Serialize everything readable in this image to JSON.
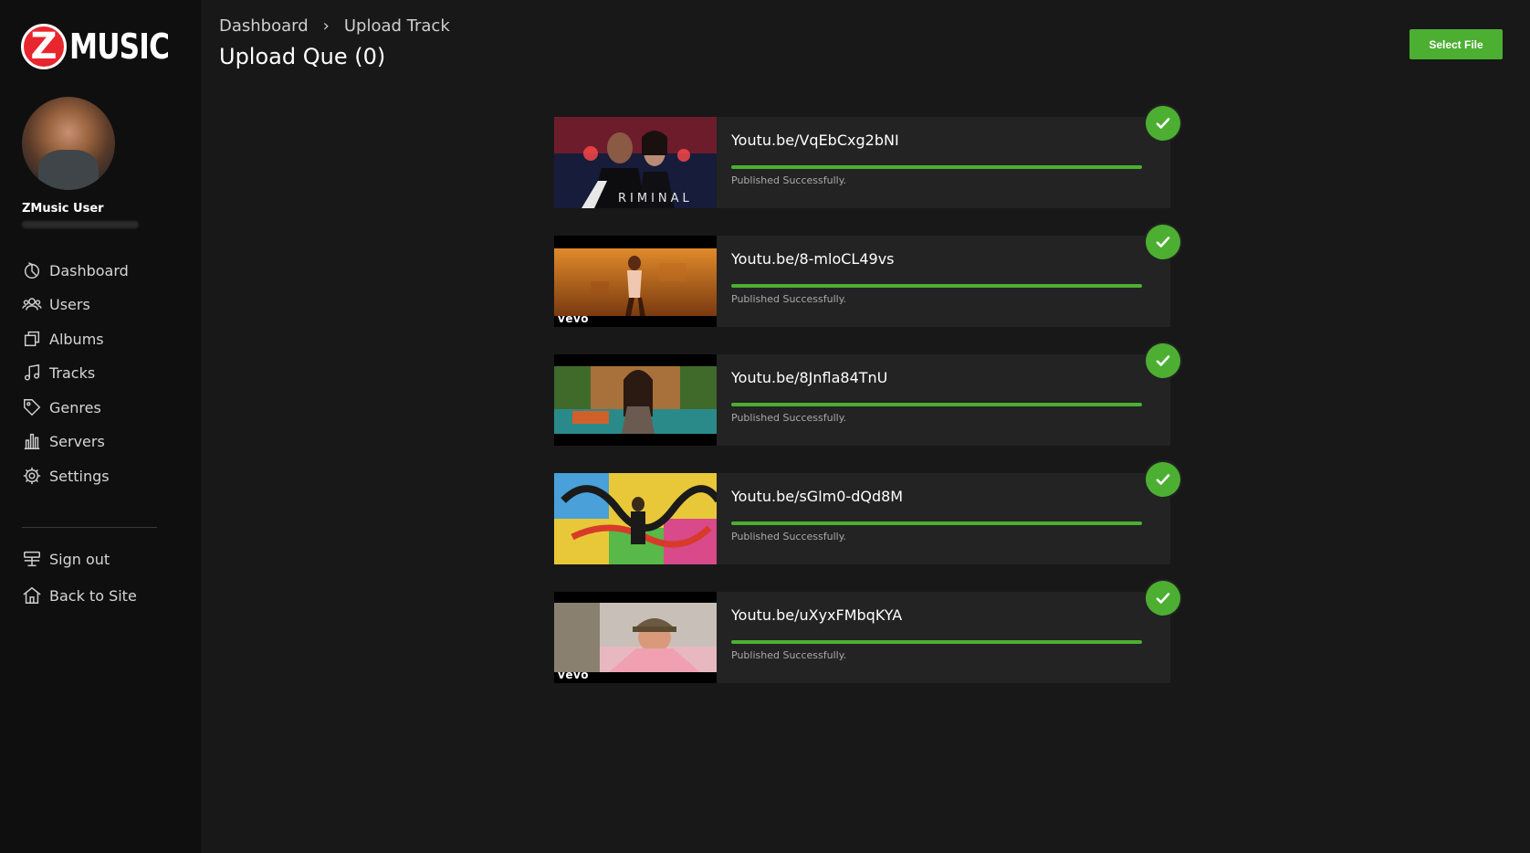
{
  "brand": {
    "logo_letter": "Z",
    "logo_text": "MUSIC",
    "accent": "#e8262d",
    "green": "#4caf32"
  },
  "user": {
    "name": "ZMusic User"
  },
  "nav": {
    "items": [
      {
        "label": "Dashboard",
        "icon": "dashboard-icon"
      },
      {
        "label": "Users",
        "icon": "users-icon"
      },
      {
        "label": "Albums",
        "icon": "albums-icon"
      },
      {
        "label": "Tracks",
        "icon": "music-note-icon"
      },
      {
        "label": "Genres",
        "icon": "tag-icon"
      },
      {
        "label": "Servers",
        "icon": "bar-chart-icon"
      },
      {
        "label": "Settings",
        "icon": "gear-icon"
      }
    ],
    "footer": [
      {
        "label": "Sign out",
        "icon": "sign-out-icon"
      },
      {
        "label": "Back to Site",
        "icon": "home-icon"
      }
    ]
  },
  "header": {
    "breadcrumb": [
      "Dashboard",
      "Upload Track"
    ],
    "breadcrumb_sep": "›",
    "title": "Upload Que (0)",
    "select_file": "Select File"
  },
  "queue": [
    {
      "url": "Youtu.be/VqEbCxg2bNI",
      "status": "Published Successfully.",
      "progress": 1.0,
      "overlay": ""
    },
    {
      "url": "Youtu.be/8-mloCL49vs",
      "status": "Published Successfully.",
      "progress": 1.0,
      "overlay": "vevo"
    },
    {
      "url": "Youtu.be/8Jnfla84TnU",
      "status": "Published Successfully.",
      "progress": 1.0,
      "overlay": ""
    },
    {
      "url": "Youtu.be/sGlm0-dQd8M",
      "status": "Published Successfully.",
      "progress": 1.0,
      "overlay": ""
    },
    {
      "url": "Youtu.be/uXyxFMbqKYA",
      "status": "Published Successfully.",
      "progress": 1.0,
      "overlay": "vevo"
    }
  ]
}
